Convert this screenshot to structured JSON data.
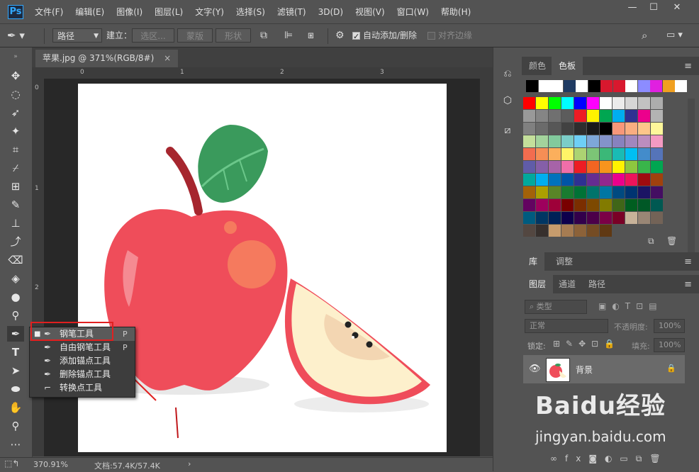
{
  "menu": {
    "logo": "Ps",
    "items": [
      "文件(F)",
      "编辑(E)",
      "图像(I)",
      "图层(L)",
      "文字(Y)",
      "选择(S)",
      "滤镜(T)",
      "3D(D)",
      "视图(V)",
      "窗口(W)",
      "帮助(H)"
    ]
  },
  "window_controls": {
    "minimize": "—",
    "maximize": "☐",
    "close": "✕"
  },
  "options": {
    "mode": "路径",
    "make_label": "建立：",
    "selection_btn": "选区...",
    "mask_btn": "蒙版",
    "shape_btn": "形状",
    "auto_add_delete": "自动添加/删除",
    "auto_add_delete_checked": true,
    "align_edges": "对齐边缘",
    "align_edges_checked": false
  },
  "document": {
    "tab_title": "苹果.jpg @ 371%(RGB/8#)",
    "tab_close": "×",
    "ruler_h_labels": [
      "0",
      "1",
      "2",
      "3"
    ],
    "ruler_v_labels": [
      "0",
      "1",
      "2"
    ]
  },
  "status": {
    "zoom": "370.91%",
    "doc_info": "文档:57.4K/57.4K",
    "arrow": "›"
  },
  "flyout": {
    "items": [
      {
        "label": "钢笔工具",
        "shortcut": "P",
        "selected": true
      },
      {
        "label": "自由钢笔工具",
        "shortcut": "P",
        "selected": false
      },
      {
        "label": "添加锚点工具",
        "shortcut": "",
        "selected": false
      },
      {
        "label": "删除锚点工具",
        "shortcut": "",
        "selected": false
      },
      {
        "label": "转换点工具",
        "shortcut": "",
        "selected": false
      }
    ]
  },
  "panels": {
    "color_tabs": [
      "颜色",
      "色板"
    ],
    "lib_tabs": [
      "库",
      "调整"
    ],
    "layer_tabs": [
      "图层",
      "通道",
      "路径"
    ],
    "filter_placeholder": "类型",
    "blend_mode": "正常",
    "opacity_label": "不透明度:",
    "opacity_value": "100%",
    "lock_label": "锁定:",
    "fill_label": "填充:",
    "fill_value": "100%",
    "layer_name": "背景"
  },
  "watermark": {
    "brand": "Baidu经验",
    "url": "jingyan.baidu.com"
  },
  "swatch_colors": {
    "top_row": [
      "#000000",
      "#ffffff",
      "#ffffff",
      "#1f3b63",
      "#ffffff",
      "#000000",
      "#d8182e",
      "#d8182e",
      "#ffffff",
      "#8c8cff",
      "#e020e0",
      "#f0a020",
      "#ffffff"
    ],
    "grid": [
      [
        "#ff0000",
        "#ffff00",
        "#00ff00",
        "#00ffff",
        "#0000ff",
        "#ff00ff",
        "#ffffff",
        "#ebebeb",
        "#d6d6d6",
        "#c2c2c2",
        "#adadad"
      ],
      [
        "#999999",
        "#858585",
        "#707070",
        "#5c5c5c",
        "#ed1c24",
        "#fff200",
        "#00a651",
        "#00aeef",
        "#2e3192",
        "#ec008c",
        "#b3b3b3"
      ],
      [
        "#808080",
        "#6b6b6b",
        "#575757",
        "#424242",
        "#2e2e2e",
        "#1a1a1a",
        "#000000",
        "#f7977a",
        "#f9ad81",
        "#fdc68a",
        "#fff79a"
      ],
      [
        "#c4df9b",
        "#a3d39c",
        "#82ca9d",
        "#7bcdc8",
        "#6ecff6",
        "#7ea7d8",
        "#8493ca",
        "#8882be",
        "#a187be",
        "#bc8dbf",
        "#f49ac2"
      ],
      [
        "#f26c4f",
        "#f68e55",
        "#fbaf5c",
        "#fff467",
        "#acd372",
        "#7cc576",
        "#3bb878",
        "#1abbb4",
        "#00bff3",
        "#438ccb",
        "#5574b9"
      ],
      [
        "#605ca8",
        "#855fa8",
        "#a763a8",
        "#f06ea9",
        "#ed1c24",
        "#f26522",
        "#f7941d",
        "#fff200",
        "#8dc73f",
        "#39b54a",
        "#00a651"
      ],
      [
        "#00a99d",
        "#00aeef",
        "#0072bc",
        "#0054a6",
        "#2e3192",
        "#662d91",
        "#92278f",
        "#ec008c",
        "#ed145b",
        "#9e0b0f",
        "#a0410d"
      ],
      [
        "#a36209",
        "#aba000",
        "#598527",
        "#197b30",
        "#007236",
        "#00746b",
        "#0076a3",
        "#004a80",
        "#003471",
        "#1b1464",
        "#440e62"
      ],
      [
        "#630460",
        "#9e005d",
        "#9e0039",
        "#790000",
        "#7b2e00",
        "#7d4900",
        "#827b00",
        "#406618",
        "#005e20",
        "#005826",
        "#005952"
      ],
      [
        "#005b7f",
        "#003663",
        "#002157",
        "#0d004c",
        "#32004b",
        "#4b0049",
        "#7b0046",
        "#7a0026",
        "#c7b299",
        "#998675",
        "#736357"
      ],
      [
        "#534741",
        "#37302d",
        "#c69c6d",
        "#a67c52",
        "#8c6239",
        "#754c24",
        "#603913"
      ]
    ]
  }
}
